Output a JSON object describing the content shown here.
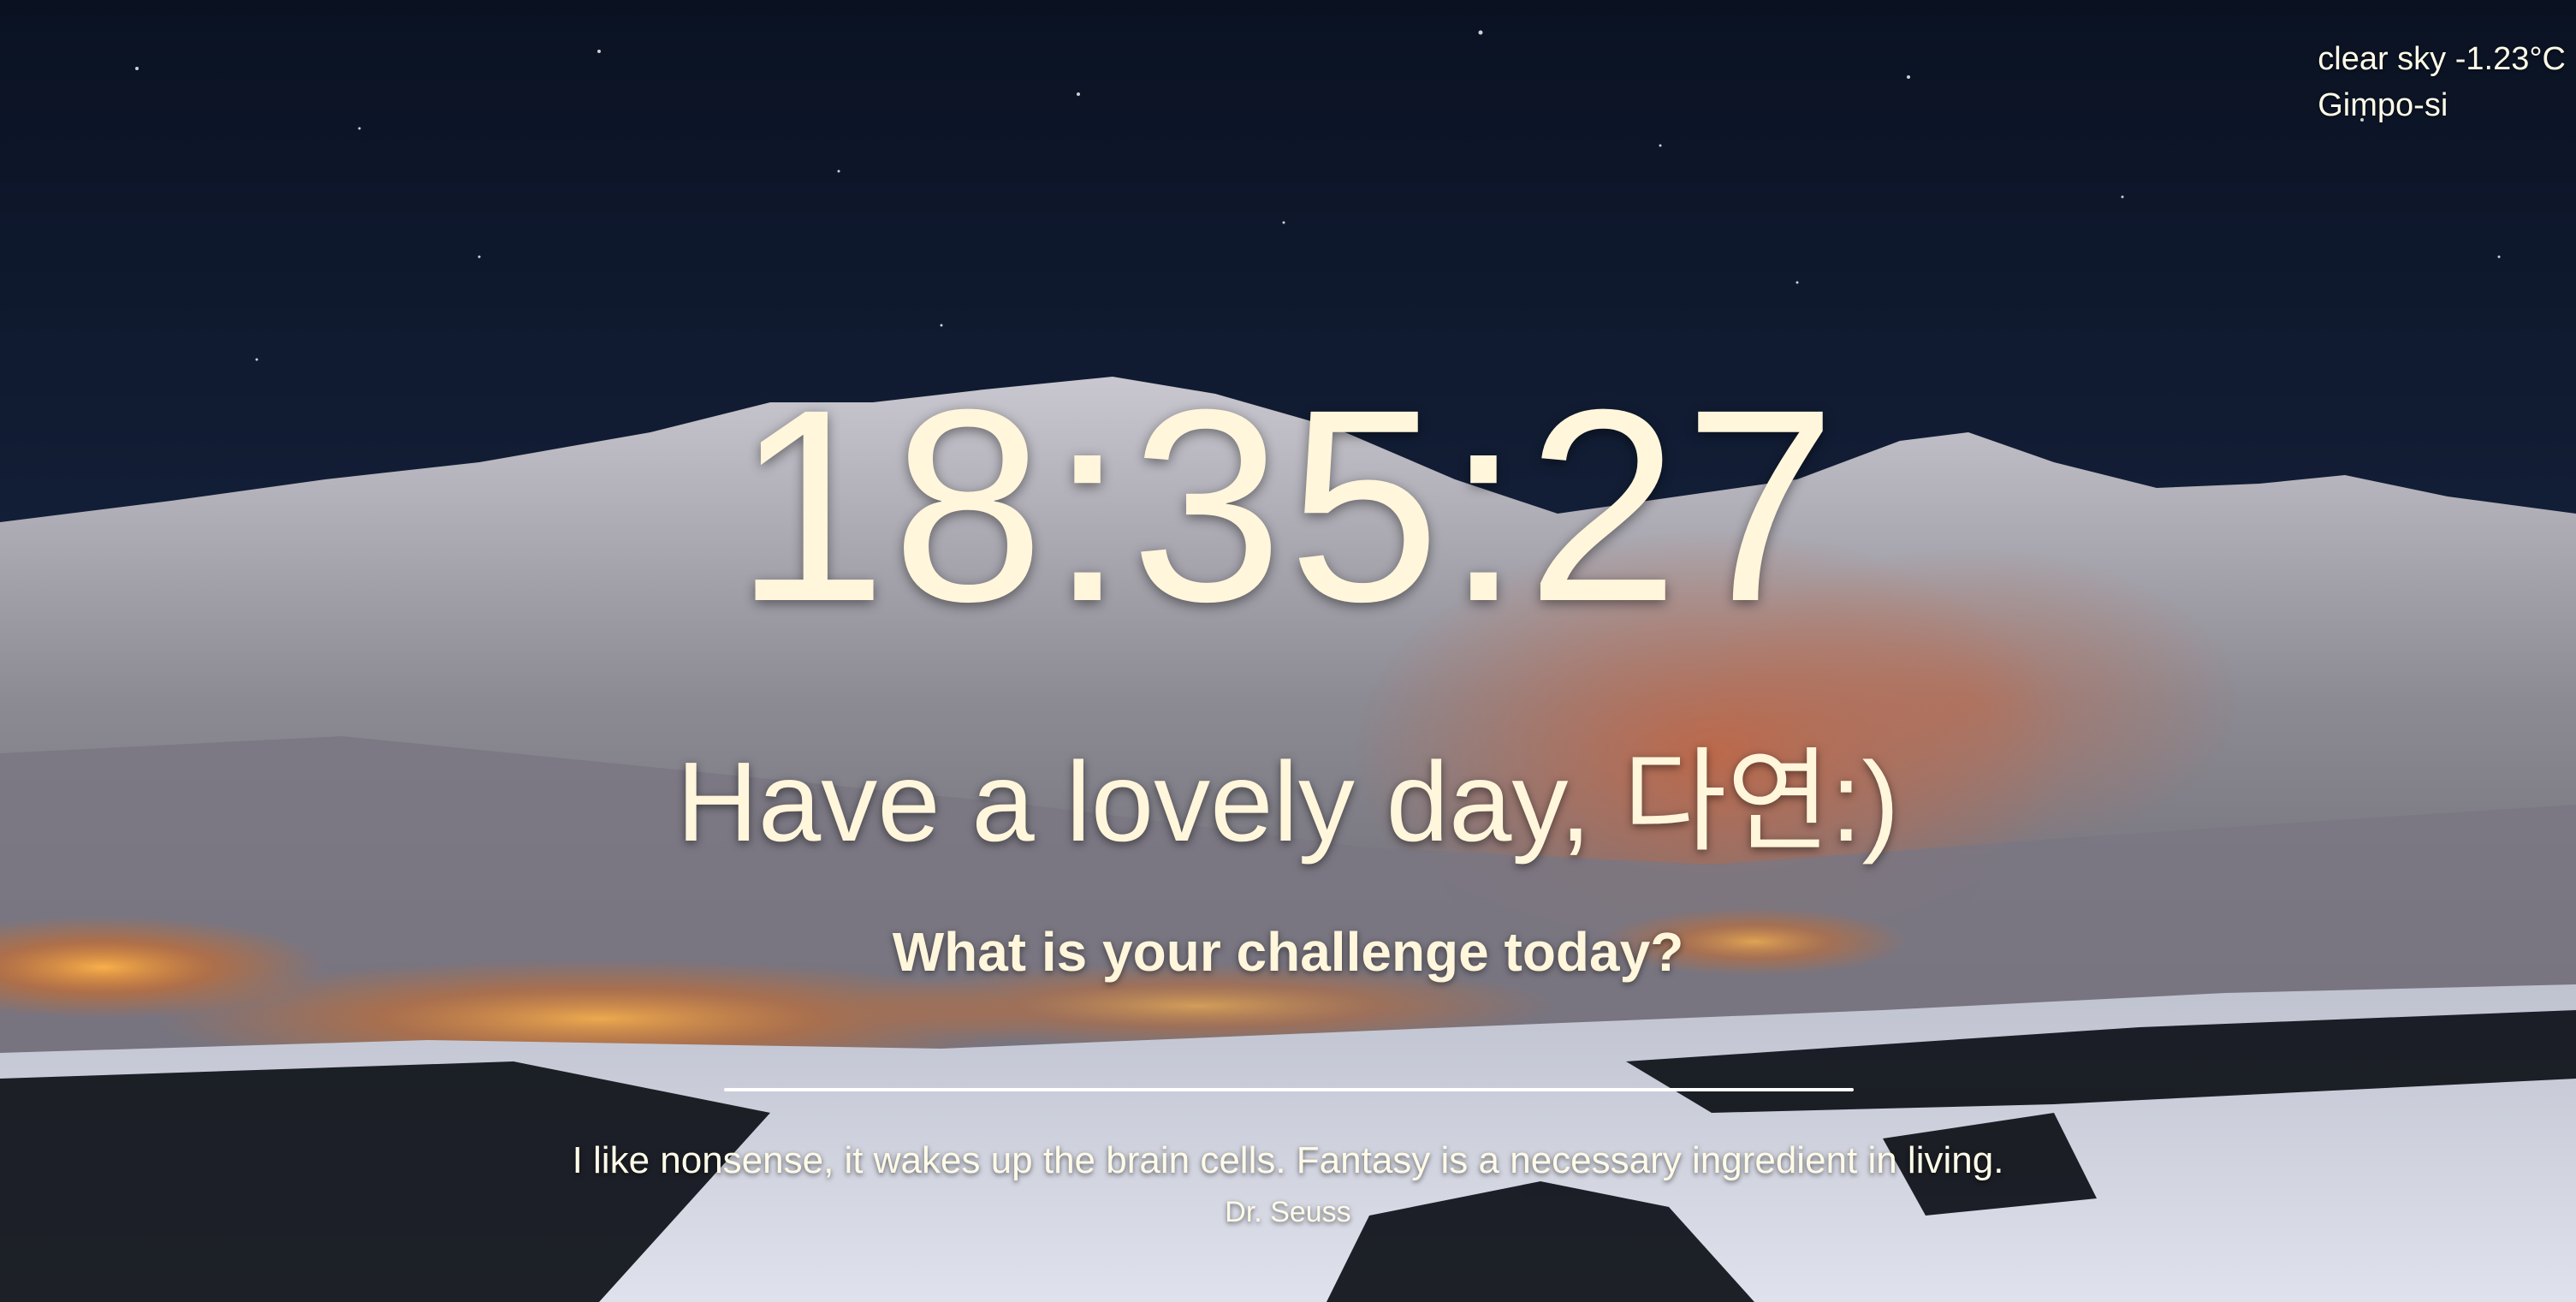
{
  "weather": {
    "condition": "clear sky",
    "temperature": "-1.23°C",
    "location": "Gimpo-si"
  },
  "clock": {
    "time": "18:35:27"
  },
  "greeting": {
    "text": "Have a lovely day, 다연:)"
  },
  "focus": {
    "prompt": "What is your challenge today?"
  },
  "quote": {
    "text": "I like nonsense, it wakes up the brain cells. Fantasy is a necessary ingredient in living.",
    "author": "Dr. Seuss"
  },
  "background": {
    "scene": "snowy-mountain-night"
  }
}
